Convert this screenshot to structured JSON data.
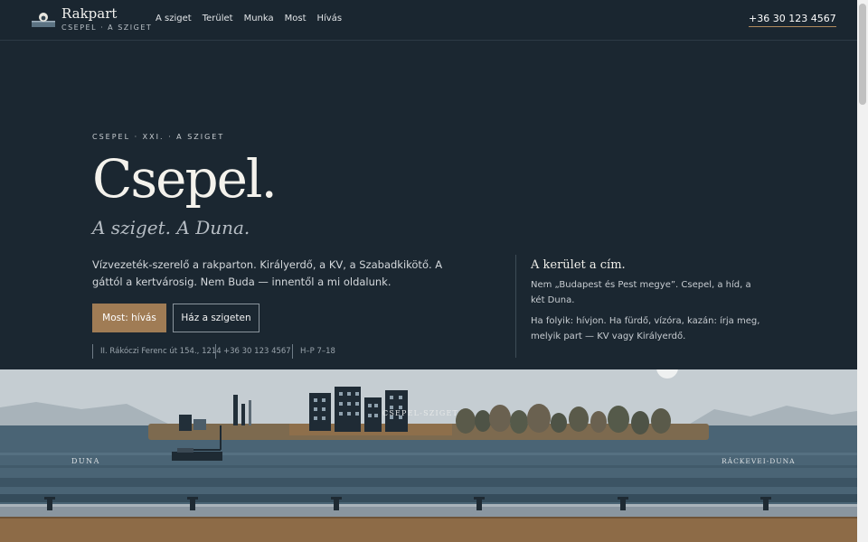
{
  "header": {
    "brand": "Rakpart",
    "brand_sub": "CSEPEL · A SZIGET",
    "nav": [
      "A sziget",
      "Terület",
      "Munka",
      "Most",
      "Hívás"
    ],
    "phone": "+36 30 123 4567"
  },
  "hero": {
    "kicker": "CSEPEL · XXI. · A SZIGET",
    "title": "Csepel.",
    "tagline": "A sziget. A Duna.",
    "lead": "Vízvezeték-szerelő a rakparton. Királyerdő, a KV, a Szabadkikötő. A gáttól a kertvárosig. Nem Buda — innentől a mi oldalunk.",
    "cta_primary": "Most: hívás",
    "cta_secondary": "Ház a szigeten",
    "meta": [
      "II. Rákóczi Ferenc út 154., 1214",
      "+36 30 123 4567",
      "H–P 7–18"
    ]
  },
  "aside": {
    "heading": "A kerület a cím.",
    "p1": "Nem „Budapest és Pest megye”. Csepel, a híd, a két Duna.",
    "p2": "Ha folyik: hívjon. Ha fürdő, vízóra, kazán: írja meg, melyik part — KV vagy Királyerdő."
  },
  "illustration": {
    "island_label": "CSEPEL-SZIGET",
    "left_label": "DUNA",
    "right_label": "RÁCKEVEI-DUNA"
  },
  "colors": {
    "accent": "#a07c55",
    "background": "#1b2731",
    "water": "#4a6475",
    "sky": "#c4ccd1"
  }
}
